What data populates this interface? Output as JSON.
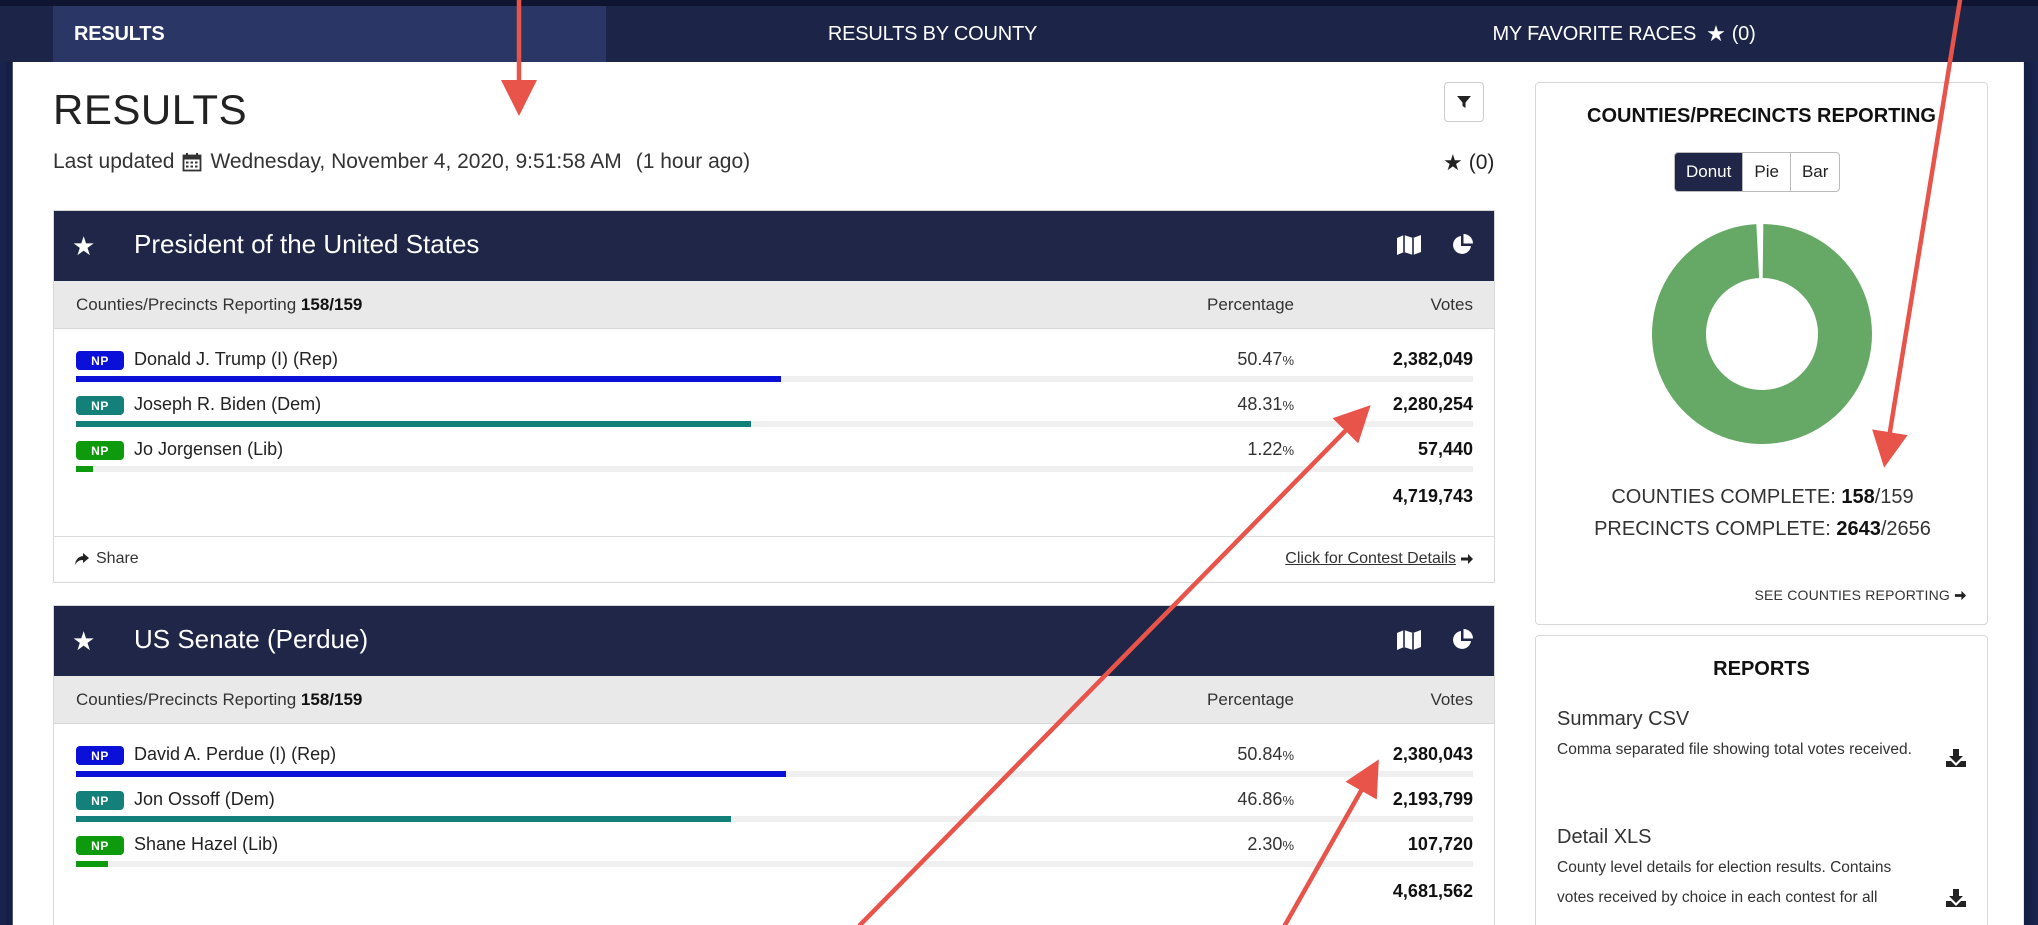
{
  "nav": {
    "tabs": [
      {
        "label": "RESULTS"
      },
      {
        "label": "RESULTS BY COUNTY"
      },
      {
        "label": "MY FAVORITE RACES"
      }
    ],
    "favorites_count": "(0)"
  },
  "header": {
    "title": "RESULTS",
    "last_updated_label": "Last updated",
    "last_updated_value": "Wednesday, November 4, 2020, 9:51:58 AM",
    "last_updated_relative": "(1 hour ago)",
    "favorites_count": "(0)"
  },
  "contests": [
    {
      "title": "President of the United States",
      "reporting_label": "Counties/Precincts Reporting",
      "reporting_value": "158/159",
      "col_percentage": "Percentage",
      "col_votes": "Votes",
      "candidates": [
        {
          "badge": "NP",
          "name": "Donald J. Trump (I) (Rep)",
          "pct": "50.47",
          "votes": "2,382,049",
          "fraction": 0.5047,
          "color": "#0a10d8"
        },
        {
          "badge": "NP",
          "name": "Joseph R. Biden (Dem)",
          "pct": "48.31",
          "votes": "2,280,254",
          "fraction": 0.4831,
          "color": "#14807a"
        },
        {
          "badge": "NP",
          "name": "Jo Jorgensen (Lib)",
          "pct": "1.22",
          "votes": "57,440",
          "fraction": 0.0122,
          "color": "#0d9a0d"
        }
      ],
      "total": "4,719,743",
      "share_label": "Share",
      "details_label": "Click for Contest Details"
    },
    {
      "title": "US Senate (Perdue)",
      "reporting_label": "Counties/Precincts Reporting",
      "reporting_value": "158/159",
      "col_percentage": "Percentage",
      "col_votes": "Votes",
      "candidates": [
        {
          "badge": "NP",
          "name": "David A. Perdue (I) (Rep)",
          "pct": "50.84",
          "votes": "2,380,043",
          "fraction": 0.5084,
          "color": "#0a10d8"
        },
        {
          "badge": "NP",
          "name": "Jon Ossoff (Dem)",
          "pct": "46.86",
          "votes": "2,193,799",
          "fraction": 0.4686,
          "color": "#14807a"
        },
        {
          "badge": "NP",
          "name": "Shane Hazel (Lib)",
          "pct": "2.30",
          "votes": "107,720",
          "fraction": 0.023,
          "color": "#0d9a0d"
        }
      ],
      "total": "4,681,562"
    }
  ],
  "pct_symbol": "%",
  "reporting_panel": {
    "title": "COUNTIES/PRECINCTS REPORTING",
    "chart_options": [
      "Donut",
      "Pie",
      "Bar"
    ],
    "active_option": "Donut",
    "donut_fraction_complete": 0.9937,
    "donut_color_complete": "#66a865",
    "counties_label": "COUNTIES COMPLETE:",
    "counties_done": "158",
    "counties_total": "/159",
    "precincts_label": "PRECINCTS COMPLETE:",
    "precincts_done": "2643",
    "precincts_total": "/2656",
    "see_link": "SEE COUNTIES REPORTING"
  },
  "reports_panel": {
    "title": "REPORTS",
    "items": [
      {
        "title": "Summary CSV",
        "desc": "Comma separated file showing total votes received."
      },
      {
        "title": "Detail XLS",
        "desc": "County level details for election results. Contains votes received by choice in each contest for all"
      }
    ]
  },
  "colors": {
    "nav_bg": "#1c2548",
    "card_header_bg": "#1f2647",
    "annotation_arrow": "#e8534a"
  }
}
